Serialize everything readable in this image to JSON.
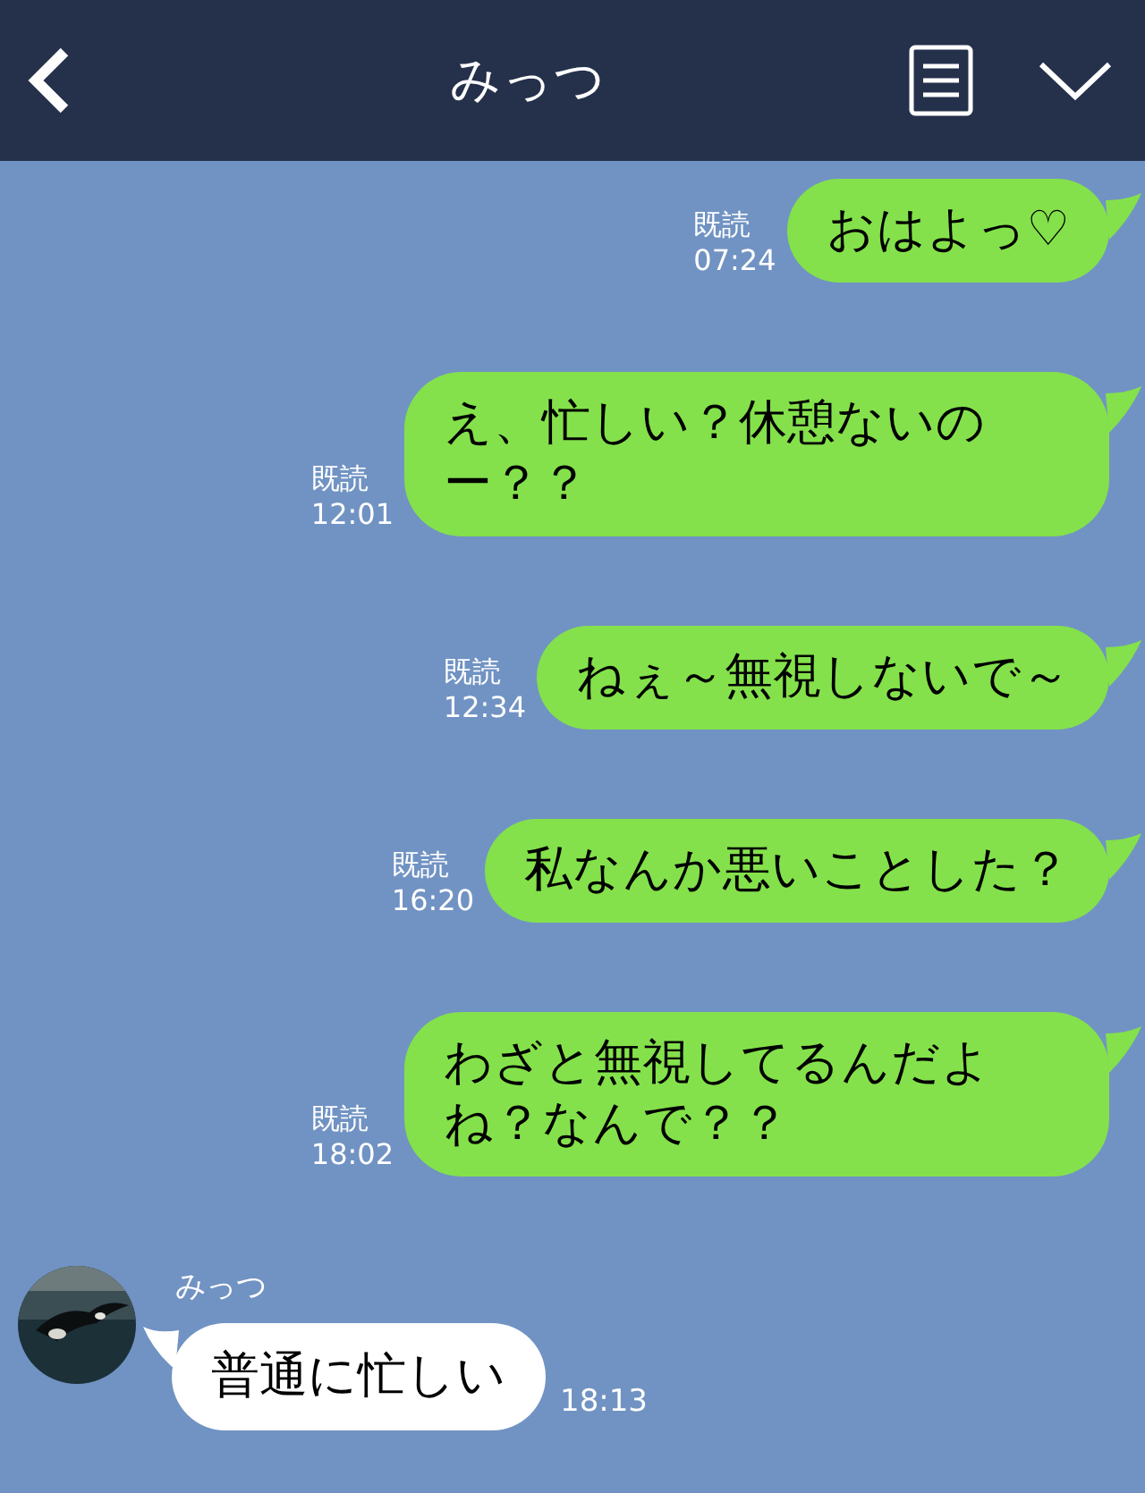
{
  "header": {
    "title": "みっつ"
  },
  "messages": [
    {
      "kind": "sent",
      "text": "おはよっ♡",
      "read": "既読",
      "time": "07:24"
    },
    {
      "kind": "sent",
      "text": "え、忙しい？休憩ないのー？？",
      "read": "既読",
      "time": "12:01"
    },
    {
      "kind": "sent",
      "text": "ねぇ～無視しないで～",
      "read": "既読",
      "time": "12:34"
    },
    {
      "kind": "sent",
      "text": "私なんか悪いことした？",
      "read": "既読",
      "time": "16:20"
    },
    {
      "kind": "sent",
      "text": "わざと無視してるんだよね？なんで？？",
      "read": "既読",
      "time": "18:02"
    },
    {
      "kind": "received",
      "sender": "みっつ",
      "text": "普通に忙しい",
      "time": "18:13"
    }
  ]
}
